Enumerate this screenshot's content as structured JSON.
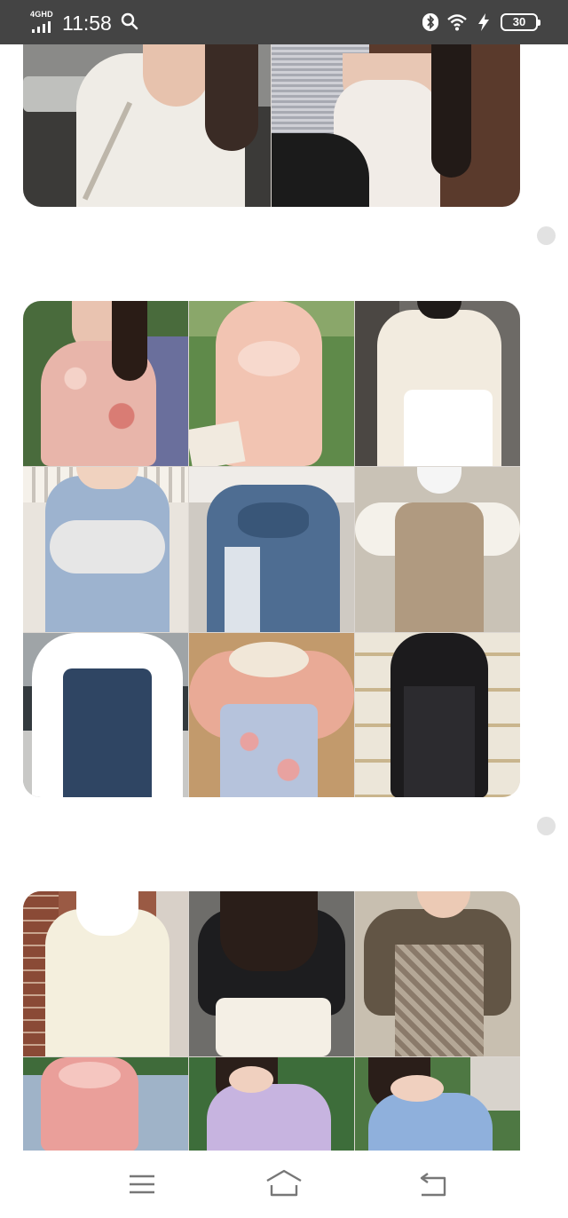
{
  "status_bar": {
    "network": "4GHD",
    "time": "11:58",
    "battery": "30"
  },
  "feed": {
    "posts": [
      {
        "id": "post-1",
        "images": [
          {
            "name": "cream-puff-sleeve-blouse-photo",
            "colors": [
              "#3b3a38",
              "#efece6",
              "#ffffff"
            ]
          },
          {
            "name": "ivory-camisole-photo",
            "colors": [
              "#5a3a2c",
              "#f1ece7",
              "#1b1b1b"
            ]
          }
        ]
      },
      {
        "id": "post-2",
        "images": [
          {
            "name": "pink-floral-sundress-photo",
            "colors": [
              "#496b3c",
              "#e8b5aa",
              "#f4d2c8"
            ]
          },
          {
            "name": "peach-tulle-dress-photo",
            "colors": [
              "#5f8a4a",
              "#f2c4b2",
              "#f7d9cd"
            ]
          },
          {
            "name": "cream-tie-neck-dress-photo",
            "colors": [
              "#6d6a66",
              "#f2ebdf",
              "#ffffff"
            ]
          },
          {
            "name": "blue-bow-top-photo",
            "colors": [
              "#e9e4dd",
              "#9db3cf",
              "#e6e6e6"
            ]
          },
          {
            "name": "denim-bow-dress-photo",
            "colors": [
              "#cfcac3",
              "#4e6d92",
              "#dde3ea"
            ]
          },
          {
            "name": "brown-vest-dress-photo",
            "colors": [
              "#d8d2c9",
              "#b09a80",
              "#f4f1ea"
            ]
          },
          {
            "name": "denim-pinafore-photo",
            "colors": [
              "#9fa4a7",
              "#2f4563",
              "#ffffff"
            ]
          },
          {
            "name": "lace-collar-floral-dress-photo",
            "colors": [
              "#b08a62",
              "#e9aa96",
              "#b6c3dc"
            ]
          },
          {
            "name": "black-lace-dress-photo",
            "colors": [
              "#e8ddc8",
              "#1c1b1d",
              "#2c2b2f"
            ]
          }
        ]
      },
      {
        "id": "post-3",
        "images": [
          {
            "name": "cream-lace-midi-dress-photo",
            "colors": [
              "#9a5a44",
              "#f4efdd",
              "#ffffff"
            ]
          },
          {
            "name": "black-cardigan-ruffle-skirt-photo",
            "colors": [
              "#6f6e6c",
              "#1d1d1f",
              "#f4efe5"
            ]
          },
          {
            "name": "plaid-dress-olive-cardigan-photo",
            "colors": [
              "#c8bfb0",
              "#625545",
              "#8a7a6a"
            ]
          },
          {
            "name": "pink-ruffle-dress-photo",
            "colors": [
              "#3f6b3a",
              "#ea9f9a",
              "#f5c6c0"
            ]
          },
          {
            "name": "lilac-floral-dress-photo",
            "colors": [
              "#3d6d3a",
              "#c7b4e0",
              "#d9ccef"
            ]
          },
          {
            "name": "blue-floral-off-shoulder-photo",
            "colors": [
              "#4e7843",
              "#8fb0dc",
              "#b9cdea"
            ]
          }
        ]
      }
    ]
  },
  "nav_bar": {
    "menu_icon": "menu-icon",
    "home_icon": "home-icon",
    "back_icon": "back-icon"
  }
}
